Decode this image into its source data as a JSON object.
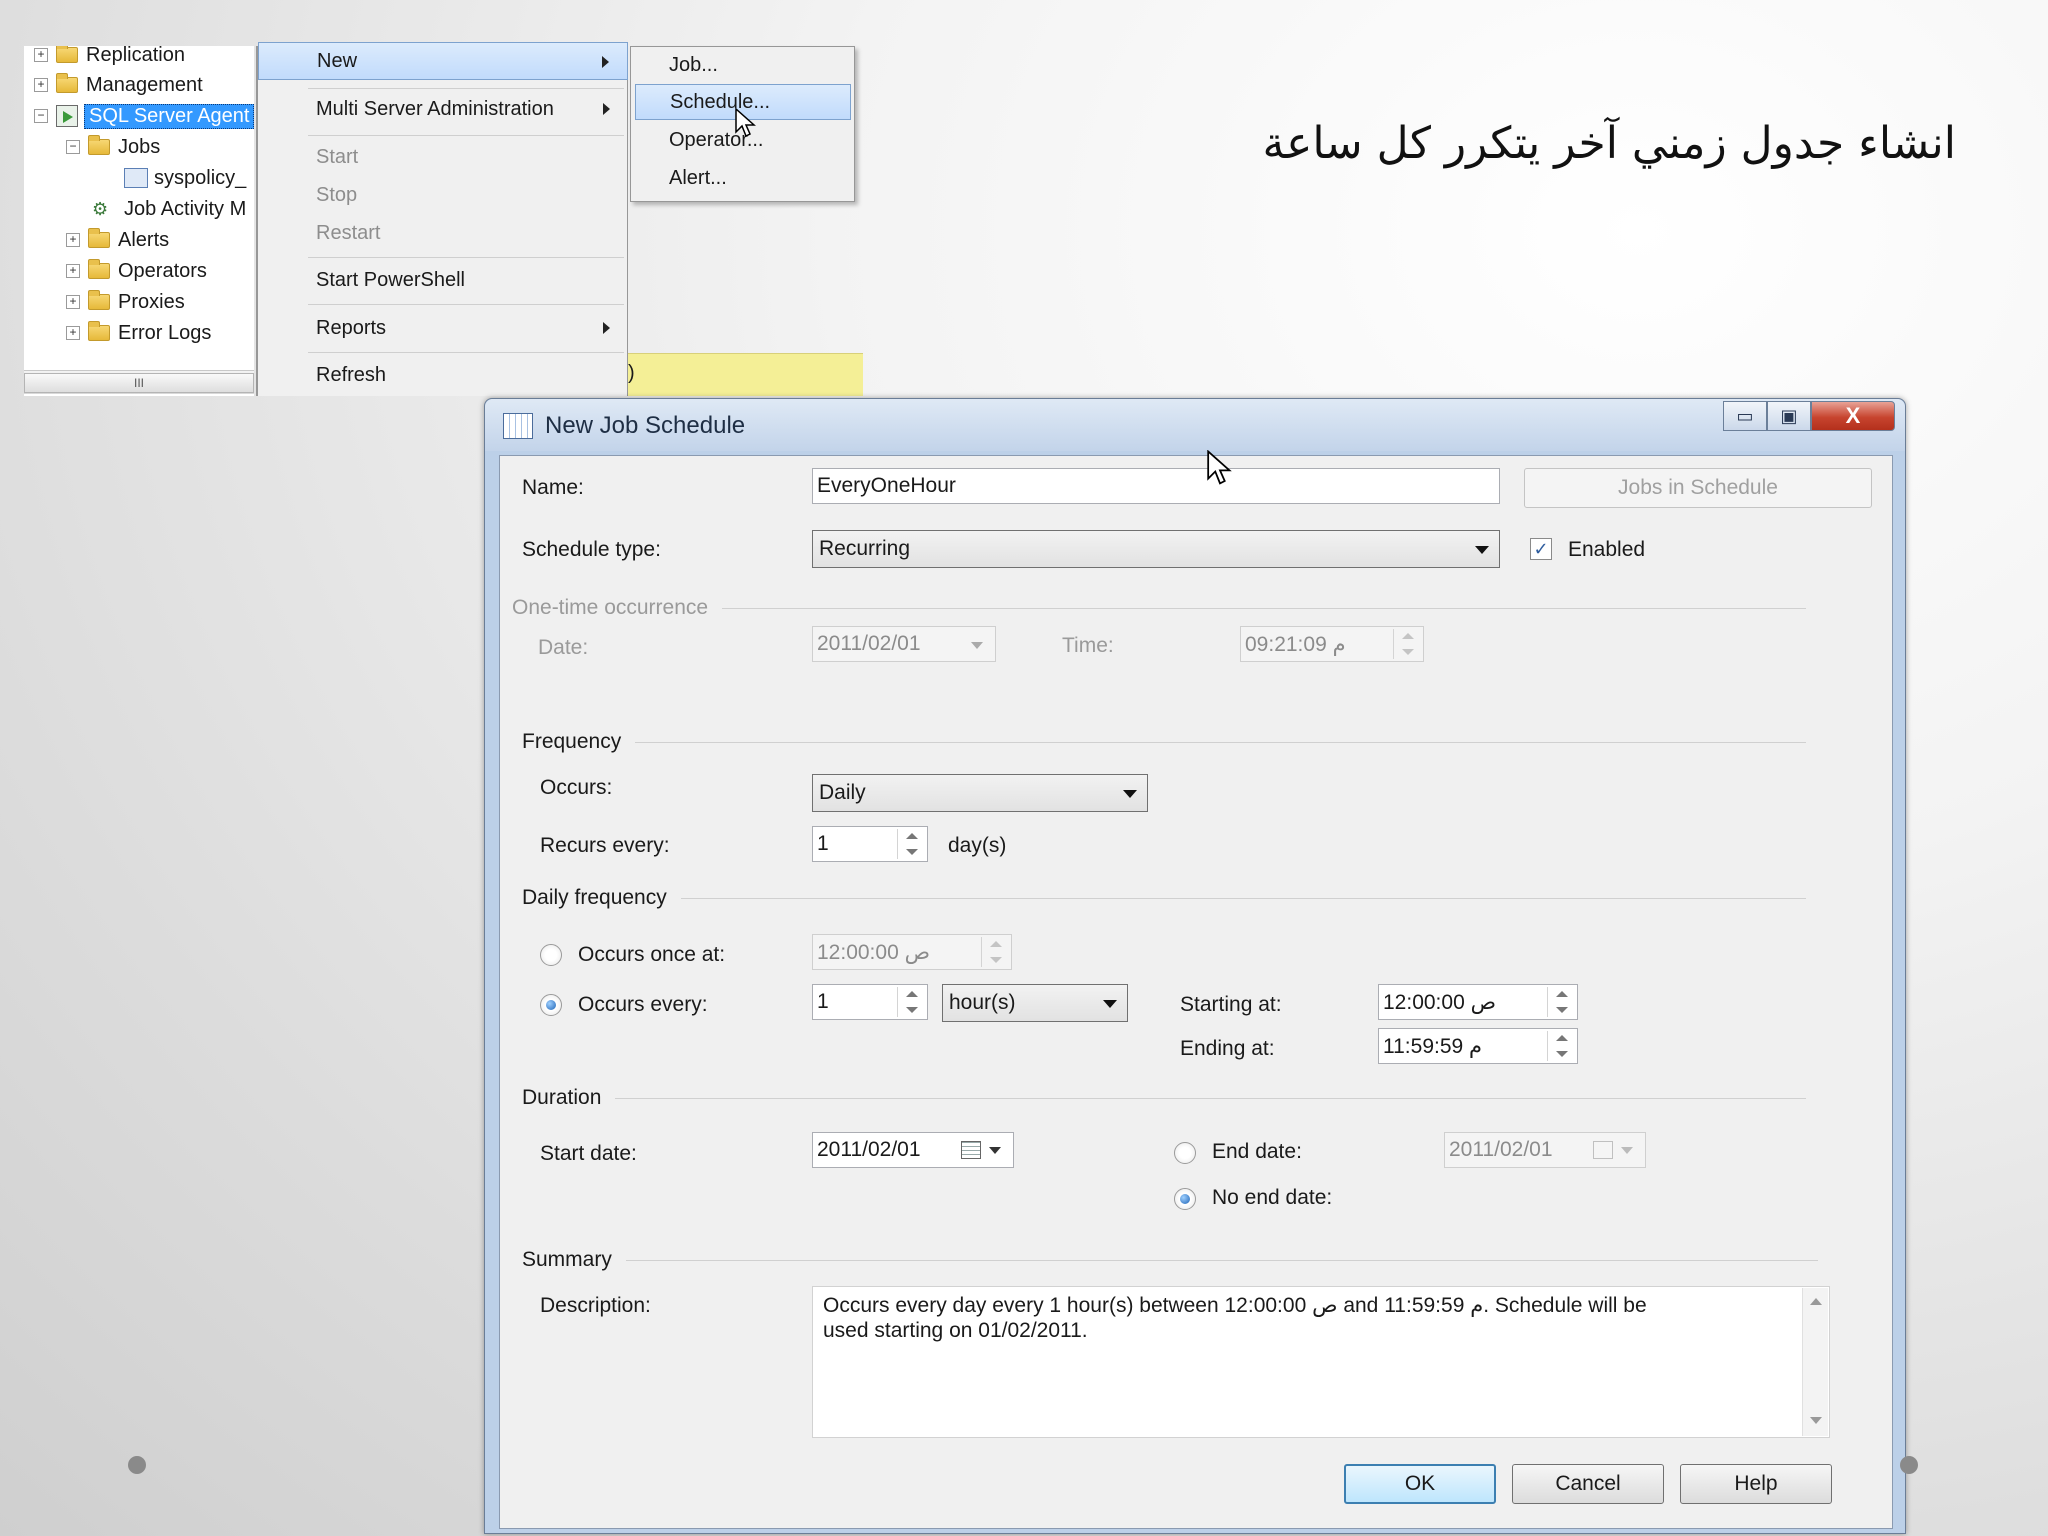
{
  "slide": {
    "title": "انشاء جدول زمني آخر يتكرر كل ساعة"
  },
  "tree": {
    "items": [
      {
        "label": "Replication"
      },
      {
        "label": "Management"
      },
      {
        "label": "SQL Server Agent"
      },
      {
        "label": "Jobs"
      },
      {
        "label": "syspolicy_"
      },
      {
        "label": "Job Activity M"
      },
      {
        "label": "Alerts"
      },
      {
        "label": "Operators"
      },
      {
        "label": "Proxies"
      },
      {
        "label": "Error Logs"
      }
    ],
    "scroll_grip": "III"
  },
  "context_menu": {
    "new": "New",
    "multi_server": "Multi Server Administration",
    "start": "Start",
    "stop": "Stop",
    "restart": "Restart",
    "start_powershell": "Start PowerShell",
    "reports": "Reports",
    "refresh": "Refresh"
  },
  "sub_menu": {
    "job": "Job...",
    "schedule": "Schedule...",
    "operator": "Operator...",
    "alert": "Alert..."
  },
  "background_fragment": ")",
  "dialog": {
    "title": "New Job Schedule",
    "window_buttons": {
      "minimize": "▭",
      "maximize": "▣",
      "close": "X"
    },
    "name_label": "Name:",
    "name_value": "EveryOneHour",
    "jobs_in_schedule": "Jobs in Schedule",
    "schedule_type_label": "Schedule type:",
    "schedule_type_value": "Recurring",
    "enabled_label": "Enabled",
    "enabled_checked": true,
    "one_time": {
      "section": "One-time occurrence",
      "date_label": "Date:",
      "date_value": "2011/02/01",
      "time_label": "Time:",
      "time_value": "09:21:09 م"
    },
    "frequency": {
      "section": "Frequency",
      "occurs_label": "Occurs:",
      "occurs_value": "Daily",
      "recurs_label": "Recurs every:",
      "recurs_value": "1",
      "recurs_unit": "day(s)"
    },
    "daily_frequency": {
      "section": "Daily frequency",
      "once_label": "Occurs once at:",
      "once_value": "12:00:00 ص",
      "every_label": "Occurs every:",
      "every_value": "1",
      "every_unit": "hour(s)",
      "starting_label": "Starting at:",
      "starting_value": "12:00:00 ص",
      "ending_label": "Ending at:",
      "ending_value": "11:59:59 م",
      "selected": "every"
    },
    "duration": {
      "section": "Duration",
      "start_label": "Start date:",
      "start_value": "2011/02/01",
      "end_label": "End date:",
      "end_value": "2011/02/01",
      "no_end_label": "No end date:",
      "selected": "no_end"
    },
    "summary": {
      "section": "Summary",
      "description_label": "Description:",
      "description": "Occurs every day every 1 hour(s) between 12:00:00 ص and 11:59:59 م. Schedule will be\nused starting on 01/02/2011."
    },
    "buttons": {
      "ok": "OK",
      "cancel": "Cancel",
      "help": "Help"
    }
  }
}
